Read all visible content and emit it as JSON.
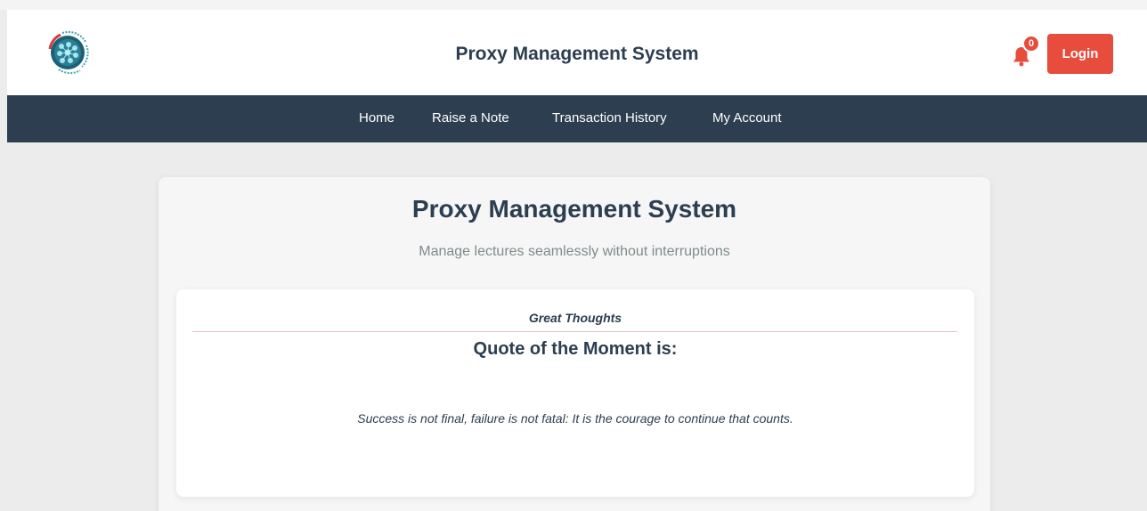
{
  "header": {
    "title": "Proxy Management System",
    "logo": {
      "icon": "pms-logo-icon",
      "ring_text_top": "Management",
      "ring_text_left": "PROXY",
      "ring_text_right": "System",
      "ring_text_bottom": "PMS"
    },
    "notifications": {
      "icon": "bell-icon",
      "count": "0"
    },
    "login_label": "Login"
  },
  "nav": {
    "items": [
      {
        "label": "Home"
      },
      {
        "label": "Raise a Note"
      },
      {
        "label": "Transaction History"
      },
      {
        "label": "My Account"
      }
    ]
  },
  "main": {
    "title": "Proxy Management System",
    "subtitle": "Manage lectures seamlessly without interruptions",
    "quote_card": {
      "heading": "Great Thoughts",
      "label": "Quote of the Moment is:",
      "quote": "Success is not final, failure is not fatal: It is the courage to continue that counts."
    }
  },
  "colors": {
    "brand_dark": "#2c3e50",
    "accent_red": "#e74c3c",
    "muted_text": "#7f8c8d",
    "page_bg": "#ececec"
  }
}
